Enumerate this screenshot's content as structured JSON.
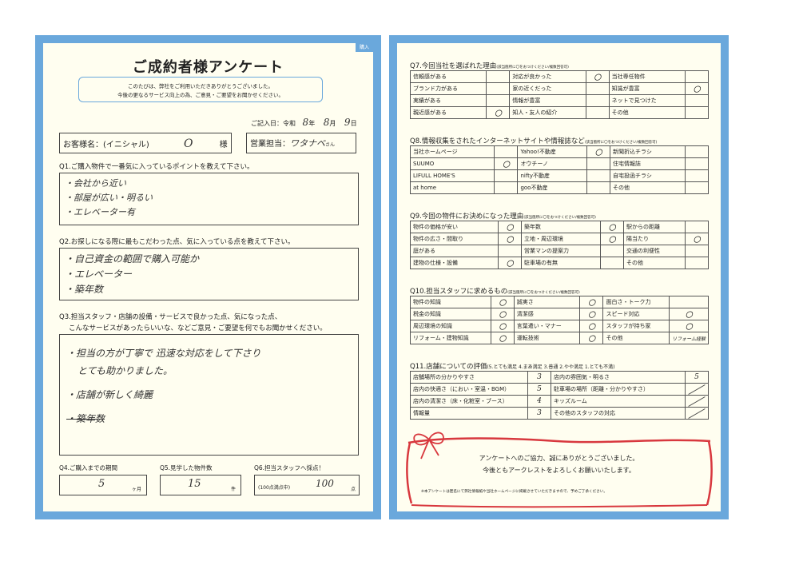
{
  "left": {
    "badge": "購入",
    "title": "ご成約者様アンケート",
    "intro": [
      "このたびは、弊社をご利用いただきありがとうございました。",
      "今後の更なるサービス向上の為、ご意見・ご要望をお聞かせください。"
    ],
    "date": {
      "label": "ご記入日：令和",
      "year": "8",
      "year_unit": "年",
      "month": "8",
      "month_unit": "月",
      "day": "9",
      "day_unit": "日"
    },
    "customer": {
      "label": "お客様名：(イニシャル)",
      "value": "O",
      "suffix": "様"
    },
    "staff": {
      "label": "営業担当：",
      "value": "ワタナベ",
      "suffix": "さん"
    },
    "q1": {
      "label": "Q1.ご購入物件で一番気に入っているポイントを教えて下さい。",
      "answers": [
        "・会社から近い",
        "・部屋が広い・明るい",
        "・エレベーター有"
      ]
    },
    "q2": {
      "label": "Q2.お探しになる際に最もこだわった点、気に入っている点を教えて下さい。",
      "answers": [
        "・自己資金の範囲で購入可能か",
        "・エレベーター",
        "・築年数"
      ]
    },
    "q3": {
      "label1": "Q3.担当スタッフ・店舗の設備・サービスで良かった点、気になった点、",
      "label2": "こんなサービスがあったらいいな、などご意見・ご要望を何でもお聞かせください。",
      "answers": [
        "・担当の方が丁寧で 迅速な対応をして下さり",
        "とても助かりました。",
        "・店舗が新しく綺麗",
        "・築年数"
      ]
    },
    "q4": {
      "label": "Q4.ご購入までの期間",
      "value": "5",
      "unit": "ヶ月"
    },
    "q5": {
      "label": "Q5.見学した物件数",
      "value": "15",
      "unit": "件"
    },
    "q6": {
      "label": "Q6.担当スタッフへ採点！",
      "prefix": "(100点満点中)",
      "value": "100",
      "unit": "点"
    }
  },
  "right": {
    "q7": {
      "label": "Q7.今回当社を選ばれた理由",
      "note": "(該当箇所に〇をおつけください/複数回答可)",
      "rows": [
        [
          [
            "信頼感がある",
            ""
          ],
          [
            "対応が良かった",
            "〇"
          ],
          [
            "当社専任物件",
            ""
          ]
        ],
        [
          [
            "ブランド力がある",
            ""
          ],
          [
            "家の近くだった",
            ""
          ],
          [
            "知識が豊富",
            "〇"
          ]
        ],
        [
          [
            "実績がある",
            ""
          ],
          [
            "情報が豊富",
            ""
          ],
          [
            "ネットで見つけた",
            ""
          ]
        ],
        [
          [
            "親近感がある",
            "〇"
          ],
          [
            "知人・友人の紹介",
            ""
          ],
          [
            "その他",
            ""
          ]
        ]
      ]
    },
    "q8": {
      "label": "Q8.情報収集をされたインターネットサイトや情報誌など",
      "note": "(該当箇所に〇をおつけください/複数回答可)",
      "rows": [
        [
          [
            "当社ホームページ",
            ""
          ],
          [
            "Yahoo!不動産",
            "〇"
          ],
          [
            "新聞折込チラシ",
            ""
          ]
        ],
        [
          [
            "SUUMO",
            "〇"
          ],
          [
            "オウチーノ",
            ""
          ],
          [
            "住宅情報誌",
            ""
          ]
        ],
        [
          [
            "LIFULL HOME'S",
            ""
          ],
          [
            "nifty不動産",
            ""
          ],
          [
            "自宅投函チラシ",
            ""
          ]
        ],
        [
          [
            "at home",
            ""
          ],
          [
            "goo不動産",
            ""
          ],
          [
            "その他",
            ""
          ]
        ]
      ]
    },
    "q9": {
      "label": "Q9.今回の物件にお決めになった理由",
      "note": "(該当箇所に〇をおつけください/複数回答可)",
      "rows": [
        [
          [
            "物件の価格が安い",
            "〇"
          ],
          [
            "築年数",
            "〇"
          ],
          [
            "駅からの距離",
            ""
          ]
        ],
        [
          [
            "物件の広さ・間取り",
            "〇"
          ],
          [
            "立地・周辺環境",
            "〇"
          ],
          [
            "陽当たり",
            "〇"
          ]
        ],
        [
          [
            "庭がある",
            ""
          ],
          [
            "営業マンの提案力",
            ""
          ],
          [
            "交通の利便性",
            ""
          ]
        ],
        [
          [
            "建物の仕様・設備",
            "〇"
          ],
          [
            "駐車場の有無",
            ""
          ],
          [
            "その他",
            ""
          ]
        ]
      ]
    },
    "q10": {
      "label": "Q10.担当スタッフに求めるもの",
      "note": "(該当箇所に〇をおつけください/複数回答可)",
      "rows": [
        [
          [
            "物件の知識",
            "〇"
          ],
          [
            "誠実さ",
            "〇"
          ],
          [
            "面白さ・トーク力",
            ""
          ]
        ],
        [
          [
            "税金の知識",
            "〇"
          ],
          [
            "清潔感",
            "〇"
          ],
          [
            "スピード対応",
            "〇"
          ]
        ],
        [
          [
            "周辺環境の知識",
            "〇"
          ],
          [
            "言葉遣い・マナー",
            "〇"
          ],
          [
            "スタッフが持ち家",
            "〇"
          ]
        ],
        [
          [
            "リフォーム・建物知識",
            "〇"
          ],
          [
            "運転技術",
            "〇"
          ],
          [
            "その他",
            "リフォーム経験"
          ]
        ]
      ]
    },
    "q11": {
      "label": "Q11.店舗についての評価",
      "scale": "(5.とても満足  4.まあ満足  3.普通  2.やや満足  1.とても不満)",
      "rows": [
        [
          [
            "店舗場所の分かりやすさ",
            "3"
          ],
          [
            "店内の雰囲気・明るさ",
            "5"
          ]
        ],
        [
          [
            "店内の快適さ（におい・室温・BGM）",
            "5"
          ],
          [
            "駐車場の場所（距離・分かりやすさ）",
            ""
          ]
        ],
        [
          [
            "店内の清潔さ（床・化粧室・ブース）",
            "4"
          ],
          [
            "キッズルーム",
            ""
          ]
        ],
        [
          [
            "情報量",
            "3"
          ],
          [
            "その他のスタッフの対応",
            ""
          ]
        ]
      ]
    },
    "thanks": [
      "アンケートへのご協力、誠にありがとうございました。",
      "今後ともアークレストをよろしくお願いいたします。"
    ],
    "footnote": "※本アンケートは匿名にて弊社情報紙や当社ホームページに掲載させていただきますので、予めご了承ください。",
    "ribbon_color": "#d8383e"
  }
}
